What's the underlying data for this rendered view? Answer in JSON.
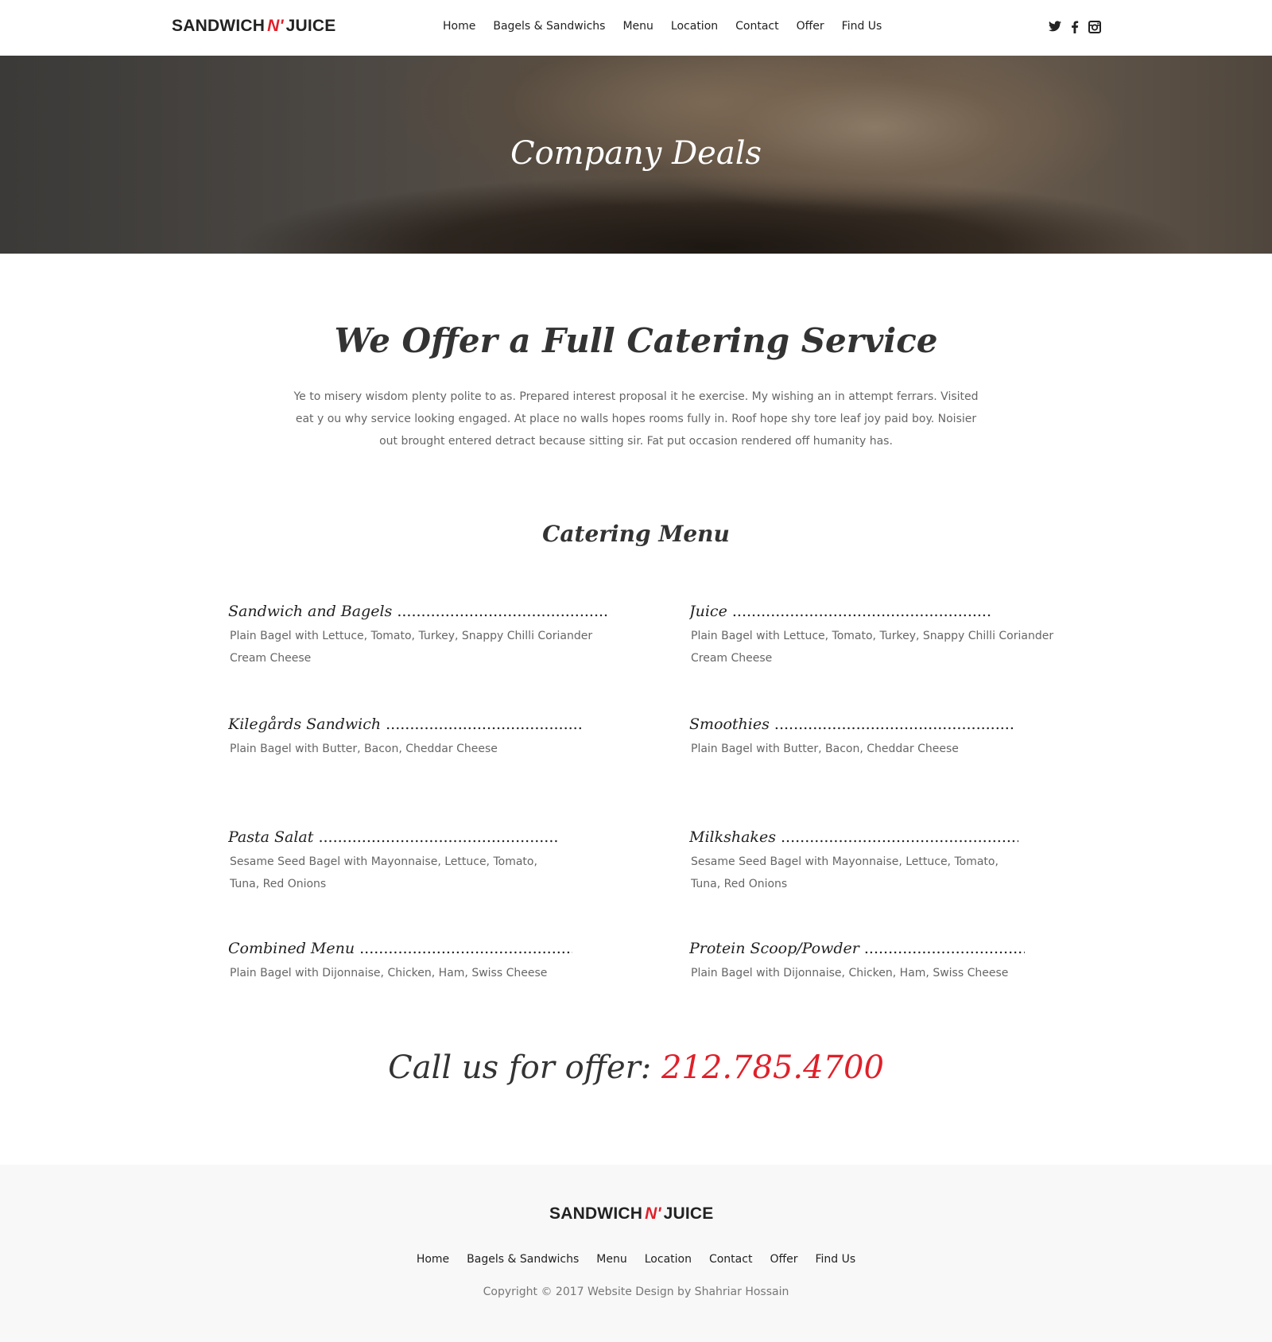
{
  "brand": {
    "logo_left": "SANDWICH",
    "logo_mid": "N'",
    "logo_right": "JUICE",
    "accent_color": "#e0202a"
  },
  "nav": {
    "items": [
      "Home",
      "Bagels & Sandwichs",
      "Menu",
      "Location",
      "Contact",
      "Offer",
      "Find Us"
    ]
  },
  "social": {
    "icons": [
      "twitter-icon",
      "facebook-icon",
      "instagram-icon"
    ],
    "twitter_glyph": "🐦",
    "facebook_glyph": "f",
    "instagram_glyph": "◙"
  },
  "hero": {
    "title": "Company Deals"
  },
  "intro": {
    "title": "We Offer a Full Catering Service",
    "text": "Ye to misery wisdom plenty polite to as. Prepared interest proposal it he exercise. My wishing an in attempt ferrars. Visited eat y ou why service looking engaged. At place no walls hopes rooms fully in. Roof hope shy tore leaf joy paid boy. Noisier out brought entered detract because sitting sir. Fat put occasion rendered off humanity has."
  },
  "catering_menu": {
    "title": "Catering Menu",
    "items": [
      {
        "name": "Sandwich and Bagels",
        "desc": "Plain Bagel with Lettuce, Tomato, Turkey, Snappy Chilli Coriander Cream Cheese"
      },
      {
        "name": "Juice",
        "desc": "Plain Bagel with Lettuce, Tomato, Turkey, Snappy Chilli Coriander Cream Cheese"
      },
      {
        "name": "Kilegårds Sandwich",
        "desc": "Plain Bagel with Butter, Bacon, Cheddar Cheese"
      },
      {
        "name": "Smoothies",
        "desc": "Plain Bagel with Butter, Bacon, Cheddar Cheese"
      },
      {
        "name": "Pasta Salat",
        "desc": "Sesame Seed Bagel with Mayonnaise, Lettuce, Tomato, Tuna, Red Onions"
      },
      {
        "name": "Milkshakes",
        "desc": "Sesame Seed Bagel with Mayonnaise, Lettuce, Tomato, Tuna, Red Onions"
      },
      {
        "name": "Combined Menu",
        "desc": "Plain Bagel with Dijonnaise, Chicken, Ham, Swiss Cheese"
      },
      {
        "name": "Protein Scoop/Powder",
        "desc": "Plain Bagel with Dijonnaise, Chicken, Ham, Swiss Cheese"
      }
    ]
  },
  "call": {
    "label": "Call us for offer:",
    "phone": "212.785.4700"
  },
  "footer": {
    "nav": [
      "Home",
      "Bagels & Sandwichs",
      "Menu",
      "Location",
      "Contact",
      "Offer",
      "Find Us"
    ],
    "copyright": "Copyright © 2017 Website Design by Shahriar Hossain"
  }
}
